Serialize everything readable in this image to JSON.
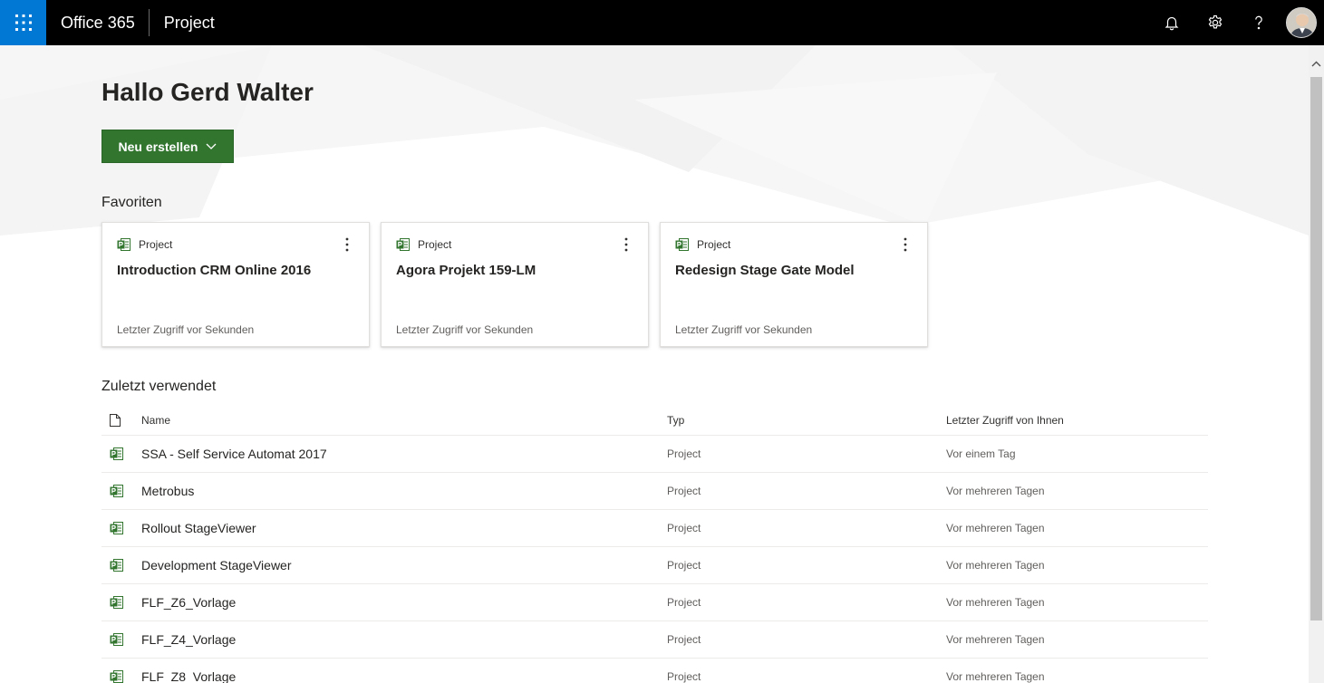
{
  "topbar": {
    "brand": "Office 365",
    "app": "Project",
    "icons": {
      "launcher": "waffle-icon",
      "notifications": "bell-icon",
      "settings": "gear-icon",
      "help": "question-icon"
    },
    "accent": "#0078d4"
  },
  "main": {
    "greeting": "Hallo Gerd Walter",
    "new_button": "Neu erstellen",
    "favorites_title": "Favoriten",
    "recent_title": "Zuletzt verwendet",
    "button_color": "#31752f"
  },
  "favorites": [
    {
      "type": "Project",
      "title": "Introduction CRM Online 2016",
      "meta": "Letzter Zugriff vor Sekunden"
    },
    {
      "type": "Project",
      "title": "Agora Projekt 159-LM",
      "meta": "Letzter Zugriff vor Sekunden"
    },
    {
      "type": "Project",
      "title": "Redesign Stage Gate Model",
      "meta": "Letzter Zugriff vor Sekunden"
    }
  ],
  "recent": {
    "columns": {
      "name": "Name",
      "type": "Typ",
      "date": "Letzter Zugriff von Ihnen"
    },
    "rows": [
      {
        "name": "SSA - Self Service Automat 2017",
        "type": "Project",
        "date": "Vor einem Tag"
      },
      {
        "name": "Metrobus",
        "type": "Project",
        "date": "Vor mehreren Tagen"
      },
      {
        "name": "Rollout StageViewer",
        "type": "Project",
        "date": "Vor mehreren Tagen"
      },
      {
        "name": "Development StageViewer",
        "type": "Project",
        "date": "Vor mehreren Tagen"
      },
      {
        "name": "FLF_Z6_Vorlage",
        "type": "Project",
        "date": "Vor mehreren Tagen"
      },
      {
        "name": "FLF_Z4_Vorlage",
        "type": "Project",
        "date": "Vor mehreren Tagen"
      },
      {
        "name": "FLF_Z8_Vorlage",
        "type": "Project",
        "date": "Vor mehreren Tagen"
      }
    ]
  }
}
